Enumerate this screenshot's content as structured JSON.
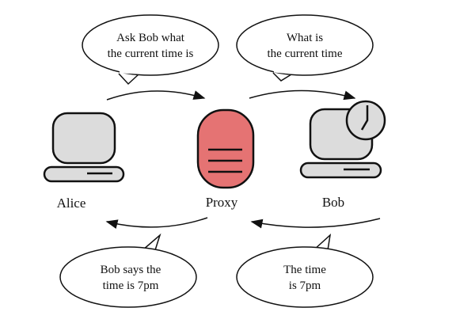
{
  "nodes": {
    "alice": {
      "label": "Alice",
      "icon": "computer-icon"
    },
    "proxy": {
      "label": "Proxy",
      "icon": "server-icon",
      "color": "#e57373"
    },
    "bob": {
      "label": "Bob",
      "icon": "computer-with-clock-icon"
    }
  },
  "bubbles": {
    "top_left": [
      "Ask Bob what",
      "the current time is"
    ],
    "top_right": [
      "What is",
      "the current time"
    ],
    "bottom_left": [
      "Bob says the",
      "time is 7pm"
    ],
    "bottom_right": [
      "The time",
      "is 7pm"
    ]
  },
  "colors": {
    "device_fill": "#dcdcdc",
    "stroke": "#111111",
    "proxy_fill": "#e57373"
  }
}
